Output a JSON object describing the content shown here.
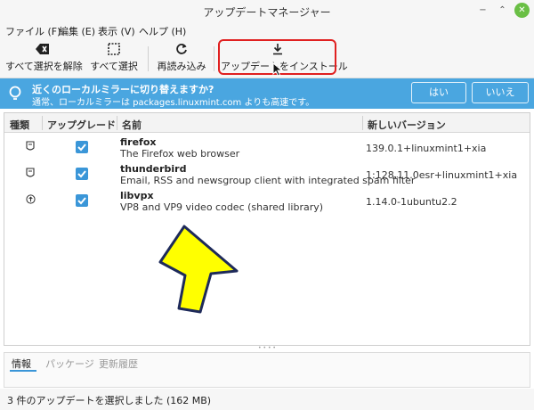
{
  "window": {
    "title": "アップデートマネージャー"
  },
  "menu": {
    "items": [
      "ファイル (F)",
      "編集 (E)",
      "表示 (V)",
      "ヘルプ (H)"
    ]
  },
  "toolbar": {
    "deselect_all": "すべて選択を解除",
    "select_all": "すべて選択",
    "refresh": "再読み込み",
    "install": "アップデートをインストール"
  },
  "infobar": {
    "title": "近くのローカルミラーに切り替えますか?",
    "message": "通常、ローカルミラーは packages.linuxmint.com よりも高速です。",
    "yes": "はい",
    "no": "いいえ"
  },
  "table": {
    "headers": {
      "type": "種類",
      "upgrade": "アップグレード",
      "name": "名前",
      "version": "新しいバージョン"
    },
    "rows": [
      {
        "name": "firefox",
        "desc": "The Firefox web browser",
        "version": "139.0.1+linuxmint1+xia",
        "checked": true,
        "kind_icon": "package-icon"
      },
      {
        "name": "thunderbird",
        "desc": "Email, RSS and newsgroup client with integrated spam filter",
        "version": "1:128.11.0esr+linuxmint1+xia",
        "checked": true,
        "kind_icon": "package-icon"
      },
      {
        "name": "libvpx",
        "desc": "VP8 and VP9 video codec (shared library)",
        "version": "1.14.0-1ubuntu2.2",
        "checked": true,
        "kind_icon": "security-update-icon"
      }
    ]
  },
  "bottom_tabs": [
    "情報",
    "パッケージ",
    "更新履歴"
  ],
  "status": "3 件のアップデートを選択しました (162 MB)",
  "colors": {
    "accent": "#3a96d8",
    "infobar": "#4aa6e0",
    "highlight": "#e02020",
    "annotation_arrow": "#ffff00"
  }
}
